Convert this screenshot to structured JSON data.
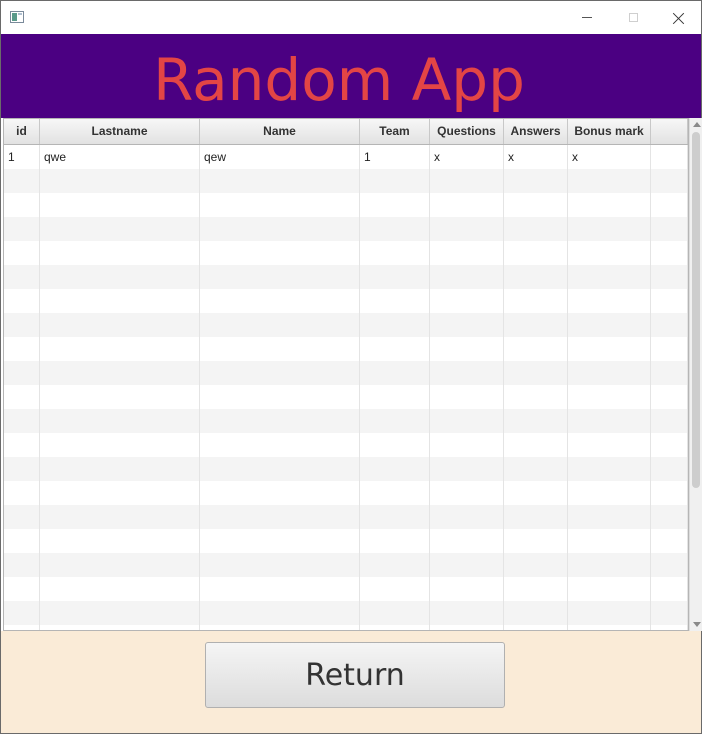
{
  "window": {
    "controls": [
      "minimize-icon",
      "maximize-icon",
      "close-icon"
    ]
  },
  "header": {
    "title": "Random App",
    "background_color": "#4b0082",
    "title_color": "#e34545"
  },
  "table": {
    "columns": [
      "id",
      "Lastname",
      "Name",
      "Team",
      "Questions",
      "Answers",
      "Bonus mark",
      ""
    ],
    "rows": [
      [
        "1",
        "qwe",
        "qew",
        "1",
        "x",
        "x",
        "x",
        ""
      ]
    ],
    "empty_rows_visible": 20
  },
  "footer": {
    "return_label": "Return",
    "background_color": "#faebd7"
  }
}
